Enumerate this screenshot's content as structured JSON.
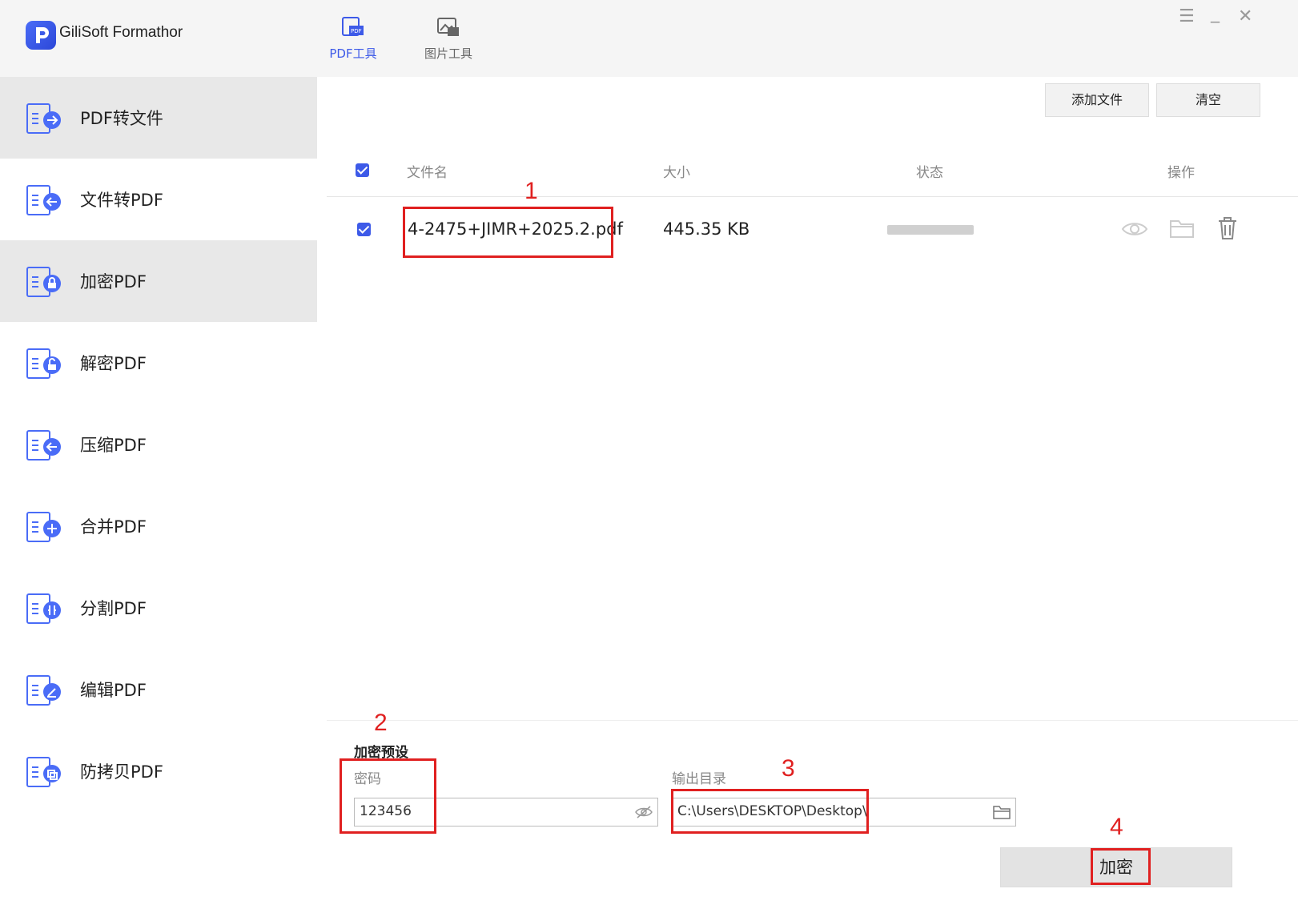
{
  "app": {
    "title": "GiliSoft Formathor"
  },
  "toolbar": {
    "tabs": [
      {
        "label": "PDF工具",
        "active": true
      },
      {
        "label": "图片工具",
        "active": false
      }
    ]
  },
  "window_controls": {
    "menu": "☰",
    "minimize": "_",
    "close": "✕"
  },
  "sidebar": {
    "items": [
      {
        "label": "PDF转文件",
        "icon": "pdf-to-file-icon"
      },
      {
        "label": "文件转PDF",
        "icon": "file-to-pdf-icon"
      },
      {
        "label": "加密PDF",
        "icon": "encrypt-pdf-icon"
      },
      {
        "label": "解密PDF",
        "icon": "decrypt-pdf-icon"
      },
      {
        "label": "压缩PDF",
        "icon": "compress-pdf-icon"
      },
      {
        "label": "合并PDF",
        "icon": "merge-pdf-icon"
      },
      {
        "label": "分割PDF",
        "icon": "split-pdf-icon"
      },
      {
        "label": "编辑PDF",
        "icon": "edit-pdf-icon"
      },
      {
        "label": "防拷贝PDF",
        "icon": "copy-protect-pdf-icon"
      }
    ]
  },
  "actions": {
    "add_file": "添加文件",
    "clear": "清空"
  },
  "table": {
    "headers": {
      "name": "文件名",
      "size": "大小",
      "status": "状态",
      "ops": "操作"
    },
    "rows": [
      {
        "name": "4-2475+JIMR+2025.2.pdf",
        "size": "445.35 KB",
        "checked": true
      }
    ]
  },
  "settings": {
    "title": "加密预设",
    "password_label": "密码",
    "password_value": "123456",
    "output_label": "输出目录",
    "output_value": "C:\\Users\\DESKTOP\\Desktop\\",
    "submit": "加密"
  },
  "annotations": {
    "m1": "1",
    "m2": "2",
    "m3": "3",
    "m4": "4"
  },
  "colors": {
    "accent": "#3d5ae8",
    "annotation": "#e02020"
  }
}
